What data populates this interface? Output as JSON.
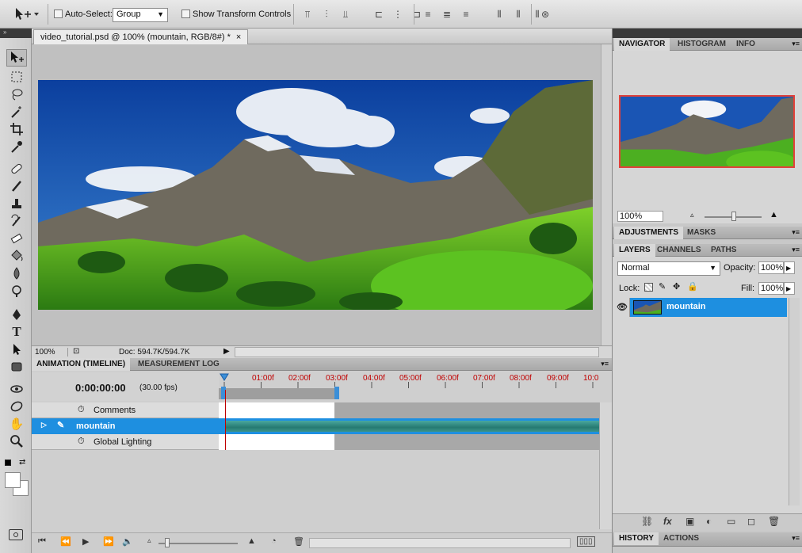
{
  "options_bar": {
    "auto_select_label": "Auto-Select:",
    "auto_select_value": "Group",
    "show_transform_label": "Show Transform Controls"
  },
  "document": {
    "tab_title": "video_tutorial.psd @ 100% (mountain, RGB/8#) *",
    "close_glyph": "×",
    "zoom": "100%",
    "doc_info": "Doc: 594.7K/594.7K"
  },
  "animation": {
    "tab_timeline": "ANIMATION (TIMELINE)",
    "tab_measurement": "MEASUREMENT LOG",
    "timecode": "0:00:00:00",
    "fps": "(30.00 fps)",
    "ruler": [
      "01:00f",
      "02:00f",
      "03:00f",
      "04:00f",
      "05:00f",
      "06:00f",
      "07:00f",
      "08:00f",
      "09:00f",
      "10:0"
    ],
    "tracks": {
      "comments": "Comments",
      "layer": "mountain",
      "global_lighting": "Global Lighting"
    }
  },
  "navigator": {
    "tabs": [
      "NAVIGATOR",
      "HISTOGRAM",
      "INFO"
    ],
    "zoom": "100%"
  },
  "adjustments": {
    "tabs": [
      "ADJUSTMENTS",
      "MASKS"
    ]
  },
  "layers": {
    "tabs": [
      "LAYERS",
      "CHANNELS",
      "PATHS"
    ],
    "blend_mode": "Normal",
    "opacity_label": "Opacity:",
    "opacity": "100%",
    "lock_label": "Lock:",
    "fill_label": "Fill:",
    "fill": "100%",
    "layer_name": "mountain"
  },
  "history": {
    "tabs": [
      "HISTORY",
      "ACTIONS"
    ]
  },
  "colors": {
    "selection": "#1e8fe0",
    "track": "#2f8a82",
    "playhead": "#c00000"
  }
}
